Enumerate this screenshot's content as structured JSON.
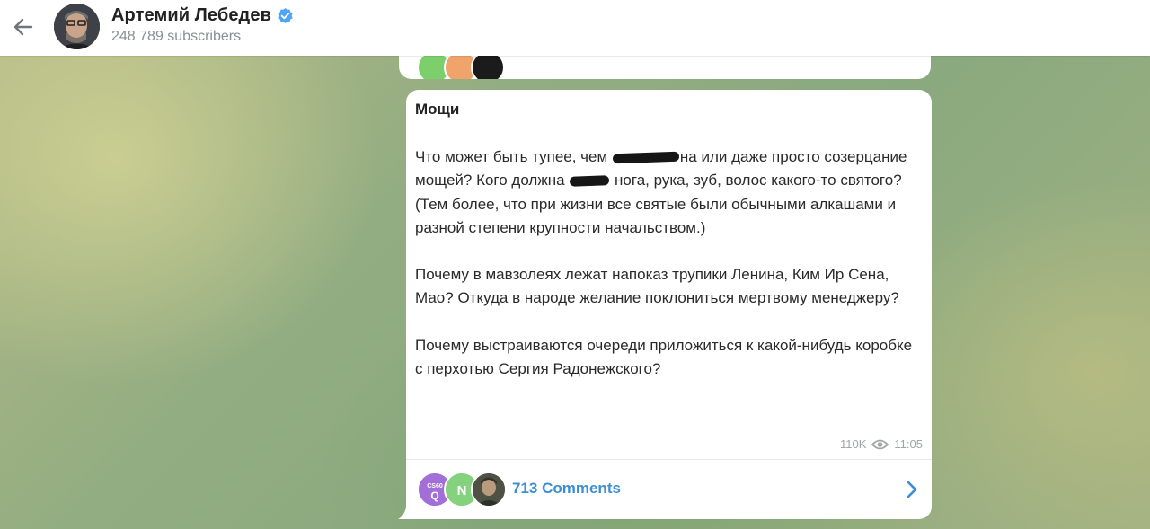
{
  "header": {
    "channel_name": "Артемий Лебедев",
    "subscribers": "248 789 subscribers",
    "back_icon": "arrow-left-icon",
    "verified_icon": "verified-badge-icon"
  },
  "message": {
    "title": "Мощи",
    "paragraphs": [
      [
        "Что может быть тупее, чем ",
        "[redacted]",
        "на или даже просто созерцание мощей? Кого должна ",
        "[redacted]",
        " нога, рука, зуб, волос какого-то святого? (Тем более, что при жизни все святые были обычными алкашами и разной степени крупности начальством.)"
      ],
      [
        "Почему в мавзолеях лежат напоказ трупики Ленина, Ким Ир Сена, Мао? Откуда в народе желание поклониться мертвому менеджеру?"
      ],
      [
        "Почему выстраиваются очереди приложиться к какой-нибудь коробке с перхотью Сергия Радонежского?"
      ]
    ],
    "views": "110K",
    "time": "11:05",
    "comments_label": "713 Comments",
    "comment_avatars": [
      "Q",
      "N",
      "photo"
    ]
  },
  "colors": {
    "accent": "#3a8fd6",
    "verified": "#4ea4f6",
    "header_bg": "#ffffff",
    "card_bg": "#ffffff"
  }
}
